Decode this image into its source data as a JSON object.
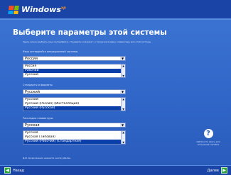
{
  "brand": {
    "name": "Windows",
    "mark": "xp"
  },
  "title": "Выберите параметры этой системы",
  "description": "Здесь можно выбрать язык интерфейса, стандарты и формат, а также раскладку клавиатуры для этой системы.",
  "sections": [
    {
      "label": "Язык интерфейса операционной системы",
      "selected": "Россия",
      "list": [
        "Россия",
        "Рабочий",
        "Русский"
      ],
      "selected_index": 1
    },
    {
      "label": "Стандарты и форматы",
      "selected": "Русский",
      "list": [
        "Русский",
        "Русский (Россия) (Инсталляция)",
        "Русский (Русская)"
      ],
      "selected_index": 2
    },
    {
      "label": "Раскладка клавиатуры",
      "selected": "Русская",
      "list": [
        "Русская",
        "Русская (Типовая)",
        "Русский (Рабочий) (Стандартная)"
      ],
      "selected_index": 2
    }
  ],
  "help": {
    "icon": "question-icon",
    "text": "Щёлкните здесь для получения справки"
  },
  "bottom_note": "Для продолжения нажмите кнопку Далее.",
  "nav": {
    "back_label": "Назад",
    "next_label": "Далее"
  },
  "colors": {
    "background": "#2457b8",
    "bar": "#1a45a6",
    "accent_green": "#2fa83b"
  }
}
